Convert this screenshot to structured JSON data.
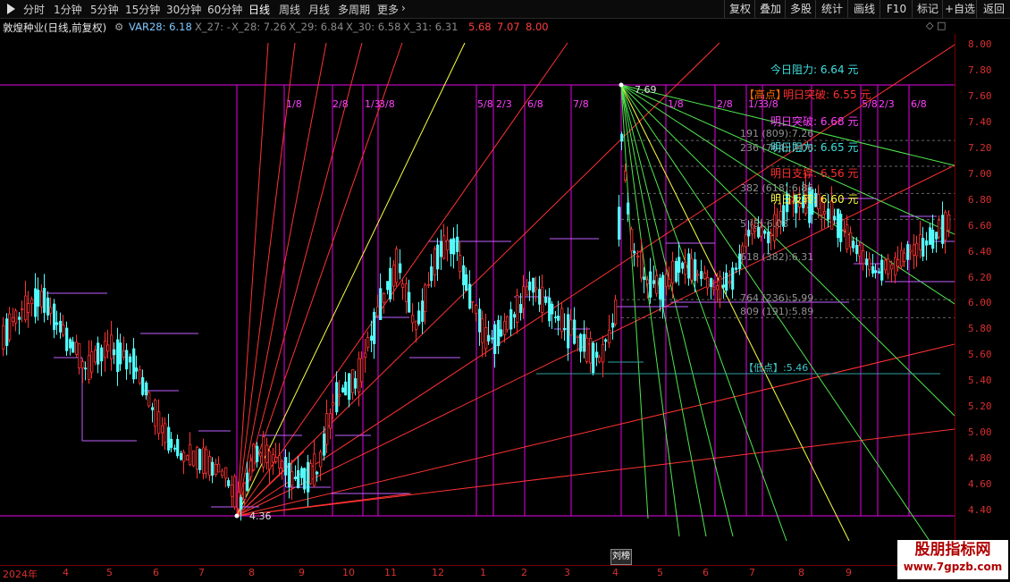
{
  "toolbar": {
    "periods": [
      {
        "label": "分时",
        "active": false
      },
      {
        "label": "1分钟",
        "active": false
      },
      {
        "label": "5分钟",
        "active": false
      },
      {
        "label": "15分钟",
        "active": false
      },
      {
        "label": "30分钟",
        "active": false
      },
      {
        "label": "60分钟",
        "active": false
      },
      {
        "label": "日线",
        "active": true
      },
      {
        "label": "周线",
        "active": false
      },
      {
        "label": "月线",
        "active": false
      },
      {
        "label": "多周期",
        "active": false
      },
      {
        "label": "更多",
        "active": false
      }
    ],
    "more_arrow": "›",
    "right_buttons": [
      "复权",
      "叠加",
      "多股",
      "统计",
      "画线",
      "F10",
      "标记",
      "+自选",
      "返回"
    ]
  },
  "infobar": {
    "title": "敦煌种业(日线,前复权)",
    "gear": "⚙",
    "var28": "VAR28: 6.18",
    "x27": "X_27: -",
    "x28": "X_28: 7.26",
    "x29": "X_29: 6.84",
    "x30": "X_30: 6.58",
    "x31": "X_31: 6.31",
    "x31b": "5.68",
    "x31c": "7.07",
    "x31d": "8.00",
    "icons": "◇ □"
  },
  "y_axis": [
    "8.00",
    "7.80",
    "7.60",
    "7.40",
    "7.20",
    "7.00",
    "6.80",
    "6.60",
    "6.40",
    "6.20",
    "6.00",
    "5.80",
    "5.60",
    "5.40",
    "5.20",
    "5.00",
    "4.80",
    "4.60",
    "4.40"
  ],
  "x_axis": [
    "2024年",
    "4",
    "5",
    "6",
    "7",
    "8",
    "9",
    "10",
    "11",
    "12",
    "1",
    "2",
    "3",
    "4",
    "5",
    "6",
    "7",
    "8",
    "9"
  ],
  "hover_tag": "刘榜",
  "annotations": {
    "low_price": "4.36",
    "high_price": "7.69",
    "left_fractions": [
      "1/8",
      "2/8",
      "1/3",
      "3/8",
      "5/8",
      "2/3",
      "6/8",
      "7/8"
    ],
    "right_fractions": [
      "1/8",
      "2/8",
      "1/3",
      "3/8",
      "5/8",
      "2/3",
      "6/8"
    ],
    "today_res": "今日阻力: 6.64 元",
    "high_tag": "【高点】",
    "tomorrow_break_a": "明日突破: 6.55 元",
    "tomorrow_break_b": "明日突破: 6.68 元",
    "fib_191": "191 (809):7.26",
    "fib_236": "236 (764):7.06",
    "tomorrow_res": "明日阻力: 6.65 元",
    "tomorrow_sup": "明日支撑: 6.56 元",
    "fib_382": "382 (618):6.85",
    "tomorrow_rev": "明日反转: 6.60 元",
    "fib_5": "5 (5):6.03",
    "fib_618": "618 (382):6.31",
    "fib_764": "764 (236):5.99",
    "fib_809": "809 (191):5.89",
    "low_tag": "【低点】:5.46"
  },
  "colors": {
    "up": "#ff3232",
    "down": "#54ffff",
    "magenta": "#e800e8",
    "axis": "#d83030",
    "yellow": "#ffff40",
    "green": "#50e850"
  },
  "watermark": {
    "title": "股朋指标网",
    "url": "www.7gpzb.com"
  }
}
